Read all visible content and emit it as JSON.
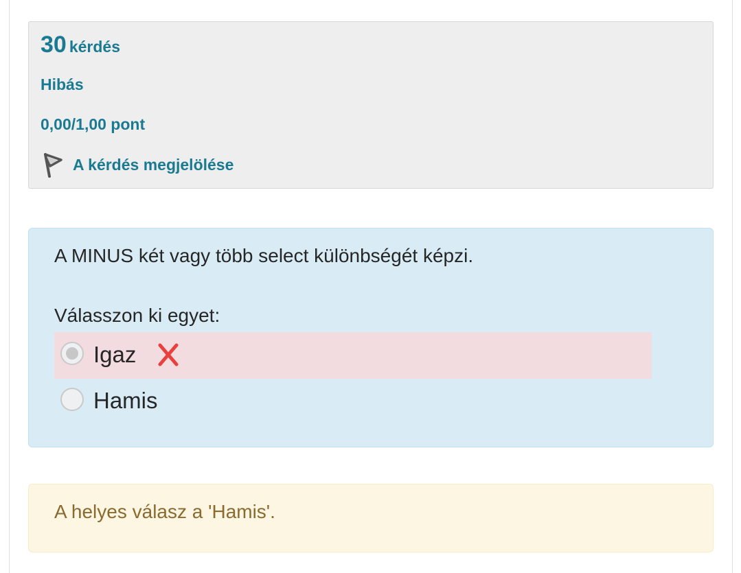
{
  "info": {
    "question_number": "30",
    "question_word": "kérdés",
    "state": "Hibás",
    "grade": "0,00/1,00 pont",
    "flag_label": "A kérdés megjelölése",
    "flag_icon": "flag-icon"
  },
  "question": {
    "text": "A MINUS két vagy több select különbségét képzi.",
    "prompt": "Válasszon ki egyet:",
    "options": [
      {
        "label": "Igaz",
        "selected": true,
        "status": "incorrect",
        "status_icon": "cross-icon"
      },
      {
        "label": "Hamis",
        "selected": false,
        "status": ""
      }
    ]
  },
  "feedback": {
    "right_answer": "A helyes válasz a 'Hamis'."
  },
  "colors": {
    "link": "#1a7a92",
    "info_bg": "#eeeeee",
    "question_bg": "#d9ecf6",
    "incorrect_bg": "#f2dcdf",
    "feedback_bg": "#fcf6e2",
    "feedback_text": "#8a6a2e",
    "cross": "#e8403f"
  }
}
